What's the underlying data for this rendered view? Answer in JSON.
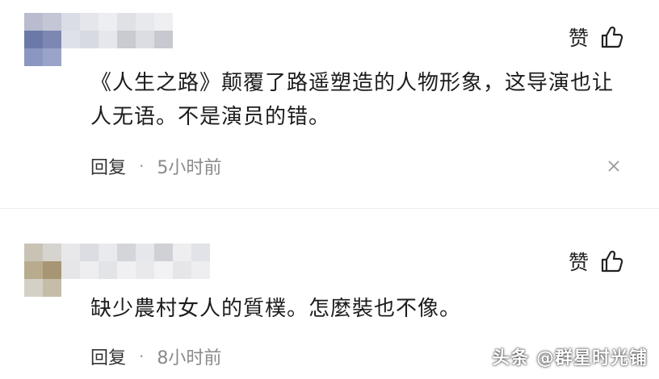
{
  "comments": [
    {
      "like_label": "赞",
      "text": "《人生之路》颠覆了路遥塑造的人物形象，这导演也让人无语。不是演员的错。",
      "reply_label": "回复",
      "separator": "·",
      "time": "5小时前"
    },
    {
      "like_label": "赞",
      "text": "缺少農村女人的質樸。怎麼裝也不像。",
      "reply_label": "回复",
      "separator": "·",
      "time": "8小时前"
    }
  ],
  "watermark": "头条 @群星时光铺",
  "icons": {
    "like": "thumbs-up-icon",
    "close": "close-icon"
  },
  "colors": {
    "text": "#1c1c1c",
    "time": "#8a8a8a",
    "background": "#ffffff"
  }
}
